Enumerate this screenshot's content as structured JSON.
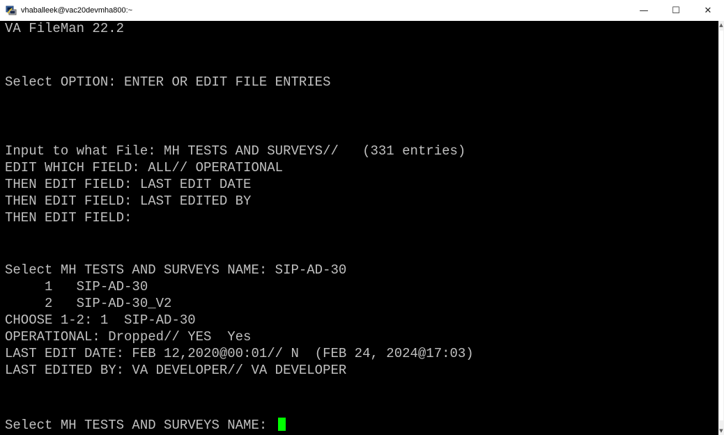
{
  "window": {
    "title": "vhaballeek@vac20devmha800:~",
    "controls": {
      "minimize": "—",
      "maximize": "☐",
      "close": "✕"
    }
  },
  "terminal": {
    "lines": [
      "VA FileMan 22.2",
      "",
      "",
      "Select OPTION: ENTER OR EDIT FILE ENTRIES",
      "",
      "",
      "",
      "Input to what File: MH TESTS AND SURVEYS//   (331 entries)",
      "EDIT WHICH FIELD: ALL// OPERATIONAL",
      "THEN EDIT FIELD: LAST EDIT DATE",
      "THEN EDIT FIELD: LAST EDITED BY",
      "THEN EDIT FIELD:",
      "",
      "",
      "Select MH TESTS AND SURVEYS NAME: SIP-AD-30",
      "     1   SIP-AD-30",
      "     2   SIP-AD-30_V2",
      "CHOOSE 1-2: 1  SIP-AD-30",
      "OPERATIONAL: Dropped// YES  Yes",
      "LAST EDIT DATE: FEB 12,2020@00:01// N  (FEB 24, 2024@17:03)",
      "LAST EDITED BY: VA DEVELOPER// VA DEVELOPER",
      "",
      "",
      "Select MH TESTS AND SURVEYS NAME: "
    ],
    "cursor_color": "#00ff00",
    "text_color": "#c0c0c0",
    "background_color": "#000000"
  },
  "icons": {
    "app": "putty-icon"
  }
}
